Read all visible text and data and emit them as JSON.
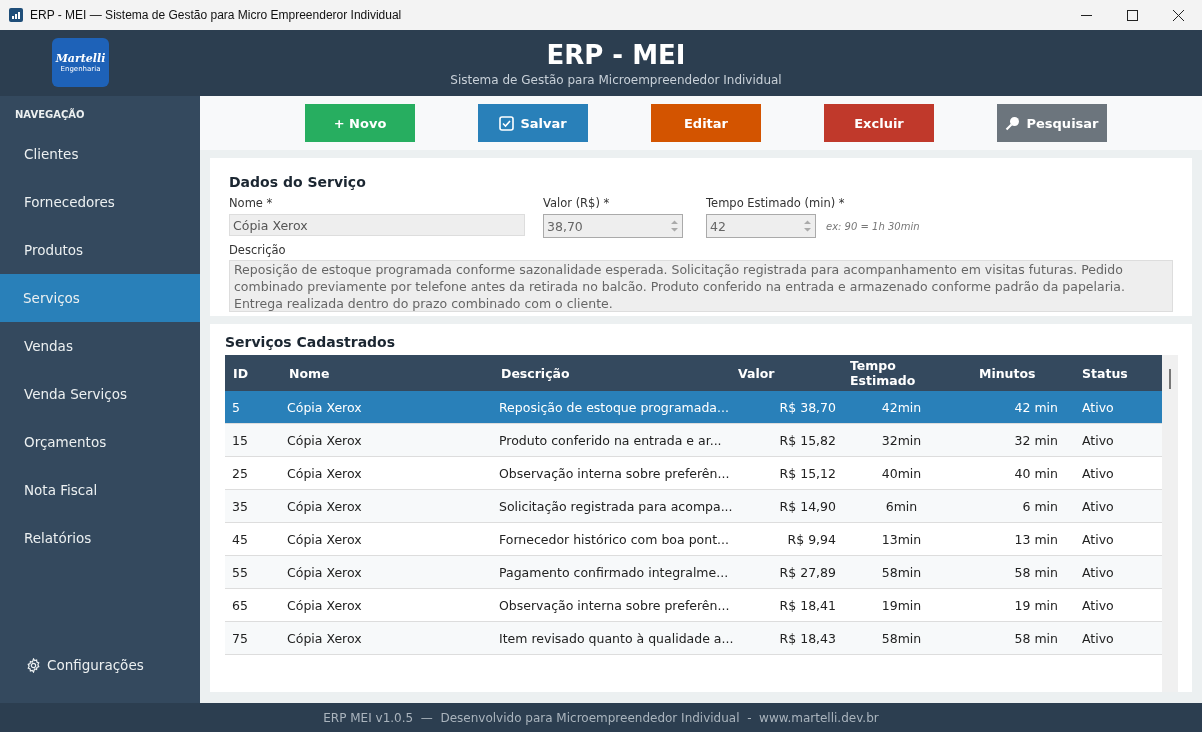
{
  "window": {
    "title": "ERP - MEI — Sistema de Gestão para Micro Empreenderor Individual"
  },
  "header": {
    "logo": "Martelli",
    "logo_sub": "Engenharia",
    "title": "ERP - MEI",
    "subtitle": "Sistema de Gestão para Microempreendedor Individual"
  },
  "sidebar": {
    "heading": "NAVEGAÇÃO",
    "items": [
      {
        "label": "Clientes",
        "selected": false
      },
      {
        "label": "Fornecedores",
        "selected": false
      },
      {
        "label": "Produtos",
        "selected": false
      },
      {
        "label": "Serviços",
        "selected": true
      },
      {
        "label": "Vendas",
        "selected": false
      },
      {
        "label": "Venda Serviços",
        "selected": false
      },
      {
        "label": "Orçamentos",
        "selected": false
      },
      {
        "label": "Nota Fiscal",
        "selected": false
      },
      {
        "label": "Relatórios",
        "selected": false
      }
    ],
    "settings": "Configurações"
  },
  "toolbar": [
    {
      "kind": "new",
      "label": "+ Novo",
      "color": "#27ae60"
    },
    {
      "kind": "save",
      "label": "Salvar",
      "color": "#2980b9"
    },
    {
      "kind": "edit",
      "label": "Editar",
      "color": "#d35400"
    },
    {
      "kind": "delete",
      "label": "Excluir",
      "color": "#c0392b"
    },
    {
      "kind": "search",
      "label": "Pesquisar",
      "color": "#6c757d"
    }
  ],
  "form": {
    "title": "Dados do Serviço",
    "name": {
      "label": "Nome *",
      "value": "Cópia Xerox"
    },
    "price": {
      "label": "Valor (R$) *",
      "value": "38,70"
    },
    "time": {
      "label": "Tempo Estimado (min) *",
      "value": "42",
      "hint": "ex: 90 = 1h 30min"
    },
    "description": {
      "label": "Descrição",
      "value": "Reposição de estoque programada conforme sazonalidade esperada. Solicitação registrada para acompanhamento em visitas futuras. Pedido combinado previamente por telefone antes da retirada no balcão. Produto conferido na entrada e armazenado conforme padrão da papelaria. Entrega realizada dentro do prazo combinado com o cliente."
    }
  },
  "table": {
    "title": "Serviços Cadastrados",
    "columns": [
      "ID",
      "Nome",
      "Descrição",
      "Valor",
      "Tempo Estimado",
      "Minutos",
      "Status"
    ],
    "rows": [
      {
        "cells": [
          "5",
          "Cópia Xerox",
          "Reposição de estoque programada...",
          "R$ 38,70",
          "42min",
          "42 min",
          "Ativo"
        ],
        "selected": true
      },
      {
        "cells": [
          "15",
          "Cópia Xerox",
          "Produto conferido na entrada e ar...",
          "R$ 15,82",
          "32min",
          "32 min",
          "Ativo"
        ],
        "selected": false
      },
      {
        "cells": [
          "25",
          "Cópia Xerox",
          "Observação interna sobre preferên...",
          "R$ 15,12",
          "40min",
          "40 min",
          "Ativo"
        ],
        "selected": false
      },
      {
        "cells": [
          "35",
          "Cópia Xerox",
          "Solicitação registrada para acompa...",
          "R$ 14,90",
          "6min",
          "6 min",
          "Ativo"
        ],
        "selected": false
      },
      {
        "cells": [
          "45",
          "Cópia Xerox",
          "Fornecedor histórico com boa pont...",
          "R$ 9,94",
          "13min",
          "13 min",
          "Ativo"
        ],
        "selected": false
      },
      {
        "cells": [
          "55",
          "Cópia Xerox",
          "Pagamento confirmado integralme...",
          "R$ 27,89",
          "58min",
          "58 min",
          "Ativo"
        ],
        "selected": false
      },
      {
        "cells": [
          "65",
          "Cópia Xerox",
          "Observação interna sobre preferên...",
          "R$ 18,41",
          "19min",
          "19 min",
          "Ativo"
        ],
        "selected": false
      },
      {
        "cells": [
          "75",
          "Cópia Xerox",
          "Item revisado quanto à qualidade a...",
          "R$ 18,43",
          "58min",
          "58 min",
          "Ativo"
        ],
        "selected": false
      }
    ]
  },
  "status_bar": "ERP MEI v1.0.5  —  Desenvolvido para Microempreendedor Individual  -  www.martelli.dev.br"
}
